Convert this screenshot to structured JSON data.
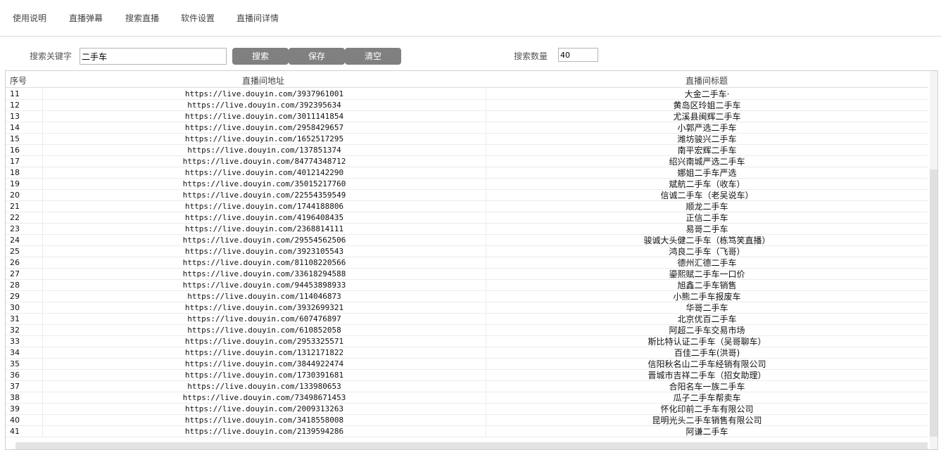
{
  "menu": [
    "使用说明",
    "直播弹幕",
    "搜索直播",
    "软件设置",
    "直播间详情"
  ],
  "search": {
    "keyword_label": "搜索关键字",
    "keyword_value": "二手车",
    "search_button": "搜索",
    "save_button": "保存",
    "clear_button": "清空",
    "count_label": "搜索数量",
    "count_value": "40"
  },
  "table": {
    "headers": {
      "index": "序号",
      "url": "直播间地址",
      "title": "直播间标题"
    },
    "rows": [
      {
        "index": "11",
        "url": "https://live.douyin.com/3937961001",
        "title": "大金二手车·"
      },
      {
        "index": "12",
        "url": "https://live.douyin.com/392395634",
        "title": "黄岛区玲姐二手车"
      },
      {
        "index": "13",
        "url": "https://live.douyin.com/3011141854",
        "title": "尤溪县闽辉二手车"
      },
      {
        "index": "14",
        "url": "https://live.douyin.com/2958429657",
        "title": "小郭严选二手车"
      },
      {
        "index": "15",
        "url": "https://live.douyin.com/1652517295",
        "title": "潍坊骏兴二手车"
      },
      {
        "index": "16",
        "url": "https://live.douyin.com/137851374",
        "title": "南平宏辉二手车"
      },
      {
        "index": "17",
        "url": "https://live.douyin.com/84774348712",
        "title": "绍兴南城严选二手车"
      },
      {
        "index": "18",
        "url": "https://live.douyin.com/4012142290",
        "title": "娜姐二手车严选"
      },
      {
        "index": "19",
        "url": "https://live.douyin.com/35015217760",
        "title": "斌航二手车（收车）"
      },
      {
        "index": "20",
        "url": "https://live.douyin.com/22554359549",
        "title": "信诚二手车（老吴说车）"
      },
      {
        "index": "21",
        "url": "https://live.douyin.com/1744188806",
        "title": "顺龙二手车"
      },
      {
        "index": "22",
        "url": "https://live.douyin.com/4196408435",
        "title": "正信二手车"
      },
      {
        "index": "23",
        "url": "https://live.douyin.com/2368814111",
        "title": "易哥二手车"
      },
      {
        "index": "24",
        "url": "https://live.douyin.com/29554562506",
        "title": "骏诚大头健二手车（栋笃笑直播）"
      },
      {
        "index": "25",
        "url": "https://live.douyin.com/3923105543",
        "title": "鸿良二手车（飞哥）"
      },
      {
        "index": "26",
        "url": "https://live.douyin.com/81108220566",
        "title": "德州汇德二手车"
      },
      {
        "index": "27",
        "url": "https://live.douyin.com/33618294588",
        "title": "鎏熙赋二手车一口价"
      },
      {
        "index": "28",
        "url": "https://live.douyin.com/94453898933",
        "title": "旭鑫二手车销售"
      },
      {
        "index": "29",
        "url": "https://live.douyin.com/114046873",
        "title": "小熊二手车报废车"
      },
      {
        "index": "30",
        "url": "https://live.douyin.com/3932699321",
        "title": "华哥二手车"
      },
      {
        "index": "31",
        "url": "https://live.douyin.com/607476897",
        "title": "北京优百二手车"
      },
      {
        "index": "32",
        "url": "https://live.douyin.com/610852058",
        "title": "阿超二手车交易市场"
      },
      {
        "index": "33",
        "url": "https://live.douyin.com/2953325571",
        "title": "斯比特认证二手车（吴哥聊车）"
      },
      {
        "index": "34",
        "url": "https://live.douyin.com/1312171822",
        "title": "百佳二手车(洪哥)"
      },
      {
        "index": "35",
        "url": "https://live.douyin.com/3844922474",
        "title": "信阳秋名山二手车经销有限公司"
      },
      {
        "index": "36",
        "url": "https://live.douyin.com/1730391681",
        "title": "晋城市吉祥二手车（招女助理）"
      },
      {
        "index": "37",
        "url": "https://live.douyin.com/133980653",
        "title": "合阳名车一族二手车"
      },
      {
        "index": "38",
        "url": "https://live.douyin.com/73498671453",
        "title": "瓜子二手车帮卖车"
      },
      {
        "index": "39",
        "url": "https://live.douyin.com/2009313263",
        "title": "怀化印前二手车有限公司"
      },
      {
        "index": "40",
        "url": "https://live.douyin.com/3418558008",
        "title": "昆明光头二手车销售有限公司"
      },
      {
        "index": "41",
        "url": "https://live.douyin.com/2139594286",
        "title": "阿谦二手车"
      }
    ]
  }
}
